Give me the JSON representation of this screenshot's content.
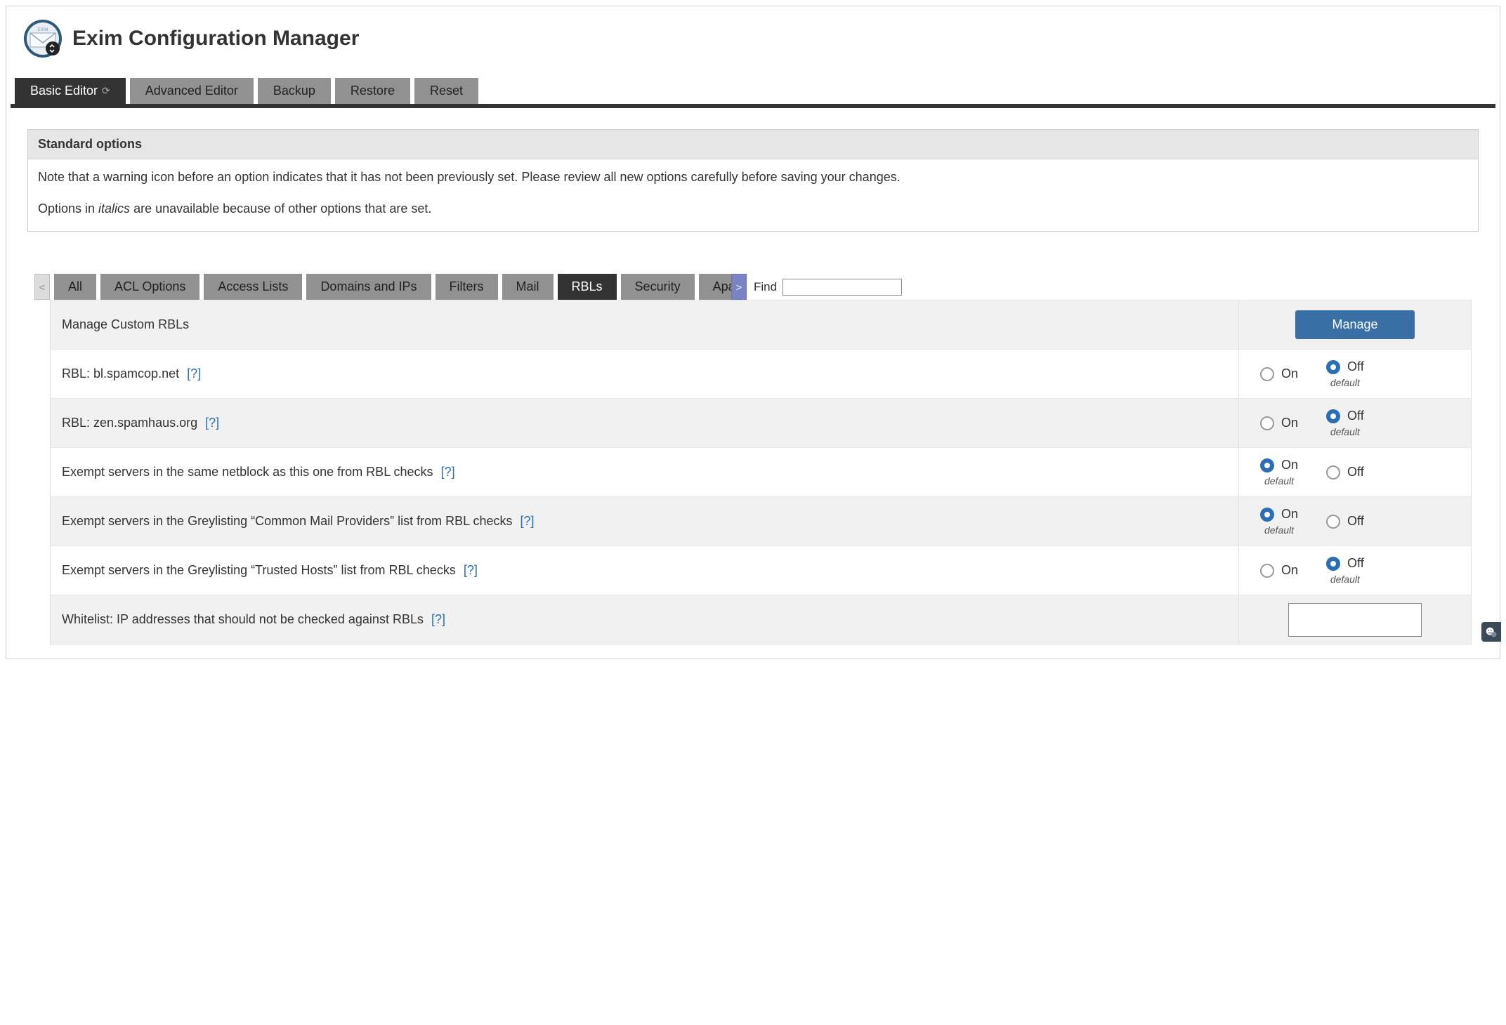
{
  "app": {
    "title": "Exim Configuration Manager"
  },
  "top_tabs": [
    {
      "id": "basic-editor",
      "label": "Basic Editor",
      "active": true,
      "has_refresh": true
    },
    {
      "id": "advanced-editor",
      "label": "Advanced Editor",
      "active": false,
      "has_refresh": false
    },
    {
      "id": "backup",
      "label": "Backup",
      "active": false,
      "has_refresh": false
    },
    {
      "id": "restore",
      "label": "Restore",
      "active": false,
      "has_refresh": false
    },
    {
      "id": "reset",
      "label": "Reset",
      "active": false,
      "has_refresh": false
    }
  ],
  "notice": {
    "header": "Standard options",
    "line1": "Note that a warning icon before an option indicates that it has not been previously set. Please review all new options carefully before saving your changes.",
    "line2_prefix": "Options in ",
    "line2_italics": "italics",
    "line2_suffix": " are unavailable because of other options that are set."
  },
  "inner_tabs": {
    "scroll_left": "<",
    "scroll_right": ">",
    "items": [
      {
        "id": "all",
        "label": "All",
        "active": false
      },
      {
        "id": "acl-options",
        "label": "ACL Options",
        "active": false
      },
      {
        "id": "access-lists",
        "label": "Access Lists",
        "active": false
      },
      {
        "id": "domains-and-ips",
        "label": "Domains and IPs",
        "active": false
      },
      {
        "id": "filters",
        "label": "Filters",
        "active": false
      },
      {
        "id": "mail",
        "label": "Mail",
        "active": false
      },
      {
        "id": "rbls",
        "label": "RBLs",
        "active": true
      },
      {
        "id": "security",
        "label": "Security",
        "active": false
      },
      {
        "id": "apache-spamassassin",
        "label": "Apache SpamAssas",
        "active": false
      }
    ]
  },
  "find": {
    "label": "Find",
    "value": ""
  },
  "controls": {
    "on_label": "On",
    "off_label": "Off",
    "default_label": "default",
    "help_label": "[?]",
    "manage_label": "Manage"
  },
  "settings_rows": [
    {
      "id": "manage-custom-rbls",
      "label": "Manage Custom RBLs",
      "type": "manage"
    },
    {
      "id": "rbl-spamcop",
      "label": "RBL: bl.spamcop.net",
      "type": "onoff",
      "help": true,
      "selected": "off",
      "default": "off"
    },
    {
      "id": "rbl-spamhaus",
      "label": "RBL: zen.spamhaus.org",
      "type": "onoff",
      "help": true,
      "selected": "off",
      "default": "off"
    },
    {
      "id": "exempt-netblock",
      "label": "Exempt servers in the same netblock as this one from RBL checks",
      "type": "onoff",
      "help": true,
      "selected": "on",
      "default": "on"
    },
    {
      "id": "exempt-greylist-common",
      "label": "Exempt servers in the Greylisting “Common Mail Providers” list from RBL checks",
      "type": "onoff",
      "help": true,
      "selected": "on",
      "default": "on"
    },
    {
      "id": "exempt-greylist-trusted",
      "label": "Exempt servers in the Greylisting “Trusted Hosts” list from RBL checks",
      "type": "onoff",
      "help": true,
      "selected": "off",
      "default": "off"
    },
    {
      "id": "whitelist-ips",
      "label": "Whitelist: IP addresses that should not be checked against RBLs",
      "type": "textarea",
      "help": true,
      "value": ""
    }
  ]
}
